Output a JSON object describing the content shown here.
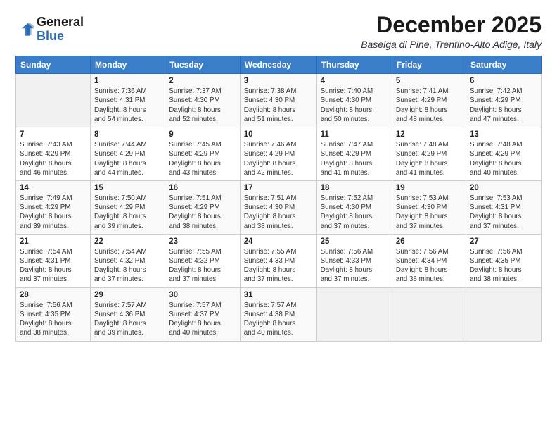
{
  "logo": {
    "line1": "General",
    "line2": "Blue"
  },
  "title": "December 2025",
  "subtitle": "Baselga di Pine, Trentino-Alto Adige, Italy",
  "days_header": [
    "Sunday",
    "Monday",
    "Tuesday",
    "Wednesday",
    "Thursday",
    "Friday",
    "Saturday"
  ],
  "weeks": [
    [
      {
        "day": "",
        "info": ""
      },
      {
        "day": "1",
        "info": "Sunrise: 7:36 AM\nSunset: 4:31 PM\nDaylight: 8 hours\nand 54 minutes."
      },
      {
        "day": "2",
        "info": "Sunrise: 7:37 AM\nSunset: 4:30 PM\nDaylight: 8 hours\nand 52 minutes."
      },
      {
        "day": "3",
        "info": "Sunrise: 7:38 AM\nSunset: 4:30 PM\nDaylight: 8 hours\nand 51 minutes."
      },
      {
        "day": "4",
        "info": "Sunrise: 7:40 AM\nSunset: 4:30 PM\nDaylight: 8 hours\nand 50 minutes."
      },
      {
        "day": "5",
        "info": "Sunrise: 7:41 AM\nSunset: 4:29 PM\nDaylight: 8 hours\nand 48 minutes."
      },
      {
        "day": "6",
        "info": "Sunrise: 7:42 AM\nSunset: 4:29 PM\nDaylight: 8 hours\nand 47 minutes."
      }
    ],
    [
      {
        "day": "7",
        "info": "Sunrise: 7:43 AM\nSunset: 4:29 PM\nDaylight: 8 hours\nand 46 minutes."
      },
      {
        "day": "8",
        "info": "Sunrise: 7:44 AM\nSunset: 4:29 PM\nDaylight: 8 hours\nand 44 minutes."
      },
      {
        "day": "9",
        "info": "Sunrise: 7:45 AM\nSunset: 4:29 PM\nDaylight: 8 hours\nand 43 minutes."
      },
      {
        "day": "10",
        "info": "Sunrise: 7:46 AM\nSunset: 4:29 PM\nDaylight: 8 hours\nand 42 minutes."
      },
      {
        "day": "11",
        "info": "Sunrise: 7:47 AM\nSunset: 4:29 PM\nDaylight: 8 hours\nand 41 minutes."
      },
      {
        "day": "12",
        "info": "Sunrise: 7:48 AM\nSunset: 4:29 PM\nDaylight: 8 hours\nand 41 minutes."
      },
      {
        "day": "13",
        "info": "Sunrise: 7:48 AM\nSunset: 4:29 PM\nDaylight: 8 hours\nand 40 minutes."
      }
    ],
    [
      {
        "day": "14",
        "info": "Sunrise: 7:49 AM\nSunset: 4:29 PM\nDaylight: 8 hours\nand 39 minutes."
      },
      {
        "day": "15",
        "info": "Sunrise: 7:50 AM\nSunset: 4:29 PM\nDaylight: 8 hours\nand 39 minutes."
      },
      {
        "day": "16",
        "info": "Sunrise: 7:51 AM\nSunset: 4:29 PM\nDaylight: 8 hours\nand 38 minutes."
      },
      {
        "day": "17",
        "info": "Sunrise: 7:51 AM\nSunset: 4:30 PM\nDaylight: 8 hours\nand 38 minutes."
      },
      {
        "day": "18",
        "info": "Sunrise: 7:52 AM\nSunset: 4:30 PM\nDaylight: 8 hours\nand 37 minutes."
      },
      {
        "day": "19",
        "info": "Sunrise: 7:53 AM\nSunset: 4:30 PM\nDaylight: 8 hours\nand 37 minutes."
      },
      {
        "day": "20",
        "info": "Sunrise: 7:53 AM\nSunset: 4:31 PM\nDaylight: 8 hours\nand 37 minutes."
      }
    ],
    [
      {
        "day": "21",
        "info": "Sunrise: 7:54 AM\nSunset: 4:31 PM\nDaylight: 8 hours\nand 37 minutes."
      },
      {
        "day": "22",
        "info": "Sunrise: 7:54 AM\nSunset: 4:32 PM\nDaylight: 8 hours\nand 37 minutes."
      },
      {
        "day": "23",
        "info": "Sunrise: 7:55 AM\nSunset: 4:32 PM\nDaylight: 8 hours\nand 37 minutes."
      },
      {
        "day": "24",
        "info": "Sunrise: 7:55 AM\nSunset: 4:33 PM\nDaylight: 8 hours\nand 37 minutes."
      },
      {
        "day": "25",
        "info": "Sunrise: 7:56 AM\nSunset: 4:33 PM\nDaylight: 8 hours\nand 37 minutes."
      },
      {
        "day": "26",
        "info": "Sunrise: 7:56 AM\nSunset: 4:34 PM\nDaylight: 8 hours\nand 38 minutes."
      },
      {
        "day": "27",
        "info": "Sunrise: 7:56 AM\nSunset: 4:35 PM\nDaylight: 8 hours\nand 38 minutes."
      }
    ],
    [
      {
        "day": "28",
        "info": "Sunrise: 7:56 AM\nSunset: 4:35 PM\nDaylight: 8 hours\nand 38 minutes."
      },
      {
        "day": "29",
        "info": "Sunrise: 7:57 AM\nSunset: 4:36 PM\nDaylight: 8 hours\nand 39 minutes."
      },
      {
        "day": "30",
        "info": "Sunrise: 7:57 AM\nSunset: 4:37 PM\nDaylight: 8 hours\nand 40 minutes."
      },
      {
        "day": "31",
        "info": "Sunrise: 7:57 AM\nSunset: 4:38 PM\nDaylight: 8 hours\nand 40 minutes."
      },
      {
        "day": "",
        "info": ""
      },
      {
        "day": "",
        "info": ""
      },
      {
        "day": "",
        "info": ""
      }
    ]
  ]
}
